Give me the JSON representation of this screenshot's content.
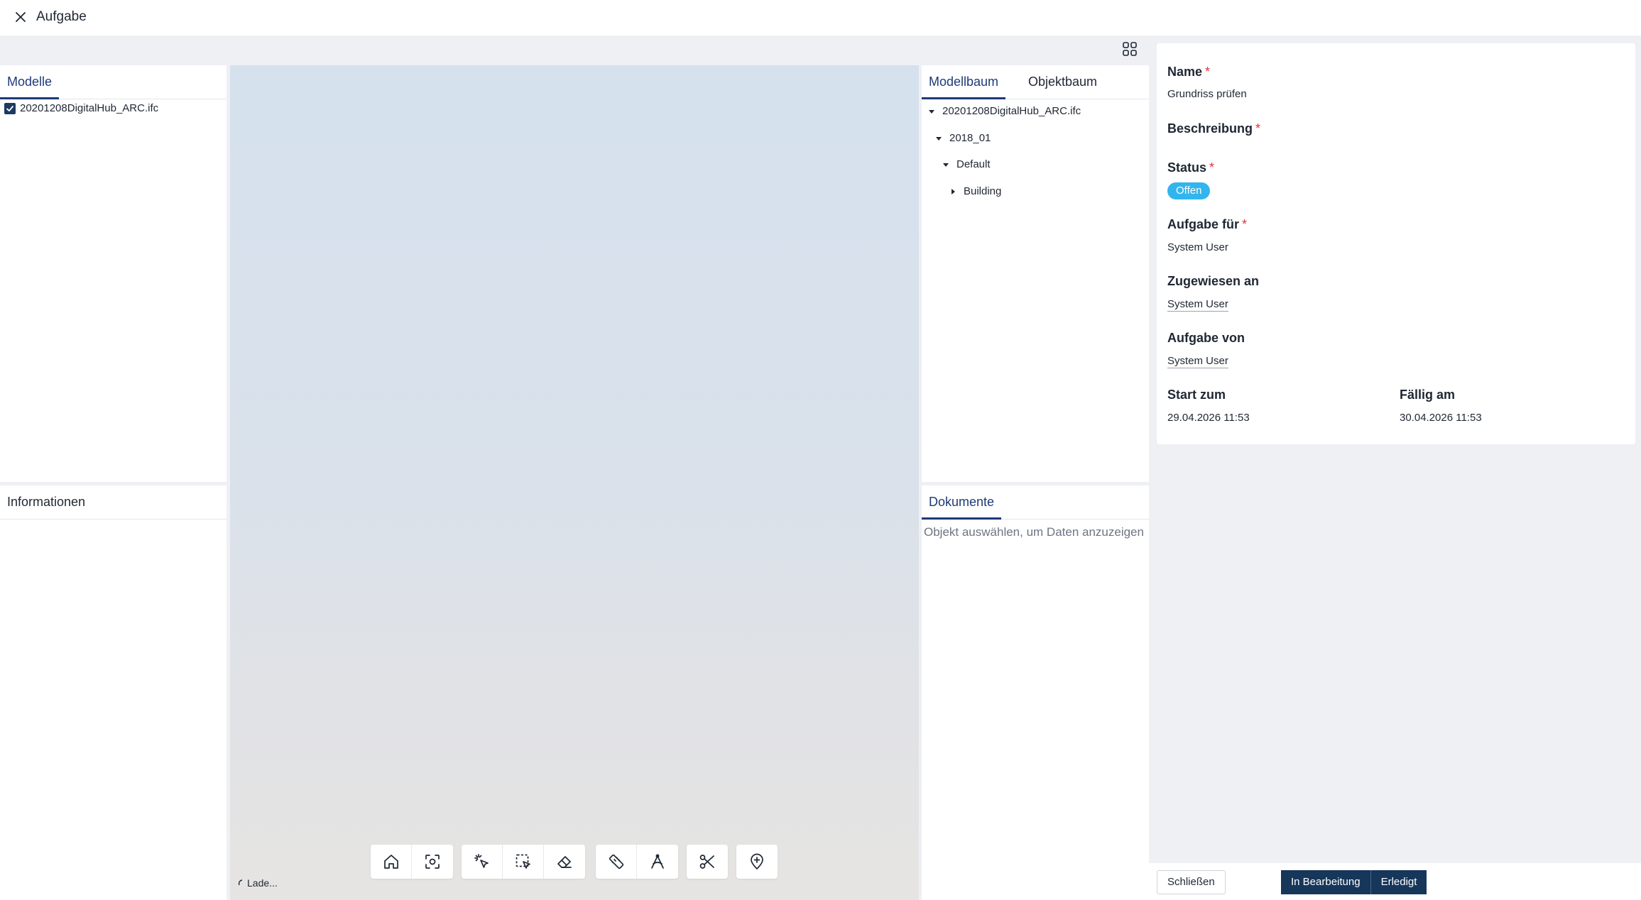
{
  "header": {
    "title": "Aufgabe"
  },
  "modelle": {
    "tab_label": "Modelle",
    "items": [
      {
        "name": "20201208DigitalHub_ARC.ifc",
        "checked": true
      }
    ]
  },
  "informationen": {
    "tab_label": "Informationen"
  },
  "tree": {
    "tabs": [
      "Modellbaum",
      "Objektbaum"
    ],
    "nodes": [
      {
        "label": "20201208DigitalHub_ARC.ifc",
        "expanded": true
      },
      {
        "label": "2018_01",
        "expanded": true
      },
      {
        "label": "Default",
        "expanded": true
      },
      {
        "label": "Building",
        "expanded": false
      }
    ]
  },
  "dokumente": {
    "tab_label": "Dokumente",
    "empty_text": "Objekt auswählen, um Daten anzuzeigen"
  },
  "viewer": {
    "loading_text": "Lade...",
    "tools": [
      "home-icon",
      "focus-icon",
      "select-pointer-icon",
      "box-select-icon",
      "eraser-icon",
      "ruler-icon",
      "angle-measure-icon",
      "scissors-icon",
      "add-pin-icon"
    ]
  },
  "task": {
    "name_label": "Name",
    "name_value": "Grundriss prüfen",
    "beschreibung_label": "Beschreibung",
    "status_label": "Status",
    "status_value": "Offen",
    "aufgabe_fuer_label": "Aufgabe für",
    "aufgabe_fuer_value": "System User",
    "zugewiesen_label": "Zugewiesen an",
    "zugewiesen_value": "System User",
    "aufgabe_von_label": "Aufgabe von",
    "aufgabe_von_value": "System User",
    "start_label": "Start zum",
    "start_value": "29.04.2026 11:53",
    "faellig_label": "Fällig am",
    "faellig_value": "30.04.2026 11:53",
    "required_mark": "*"
  },
  "footer": {
    "close_label": "Schließen",
    "in_progress_label": "In Bearbeitung",
    "done_label": "Erledigt"
  },
  "colors": {
    "primary": "#1d3a78",
    "dark_button": "#16365a",
    "status_badge": "#32b5ee",
    "required": "#e0313c"
  }
}
